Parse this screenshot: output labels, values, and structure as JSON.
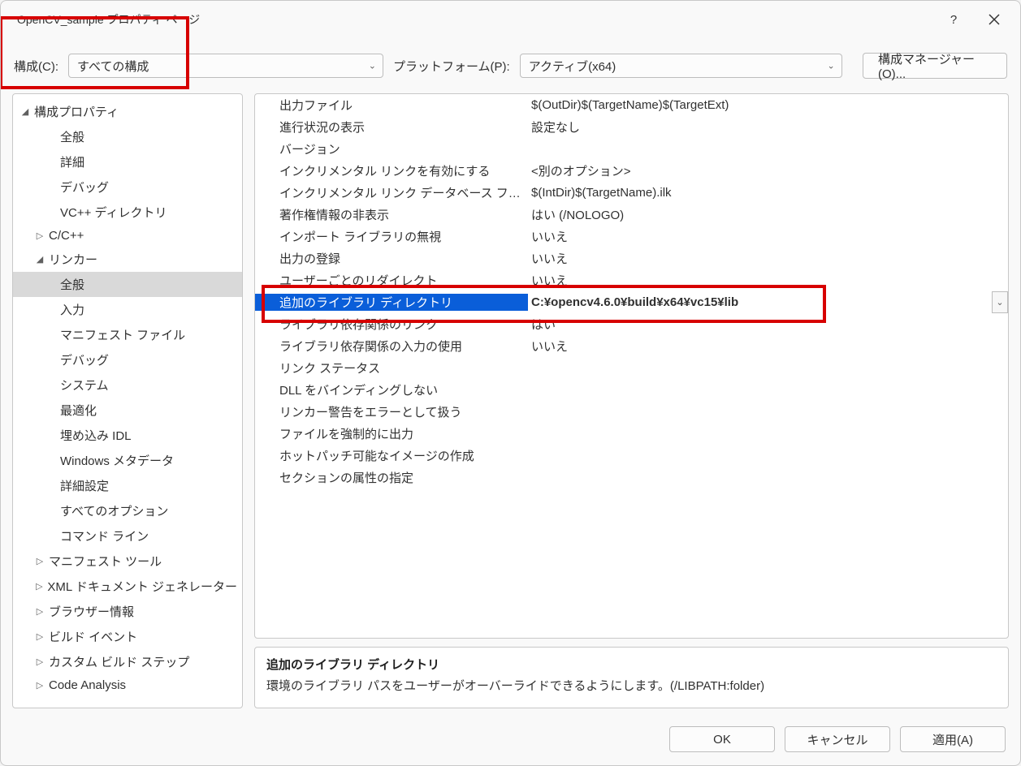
{
  "window": {
    "title": "OpenCV_sample プロパティ ページ",
    "help_icon": "?",
    "close_icon": "✕"
  },
  "toolbar": {
    "config_label": "構成(C):",
    "config_value": "すべての構成",
    "platform_label": "プラットフォーム(P):",
    "platform_value": "アクティブ(x64)",
    "manager_button": "構成マネージャー(O)..."
  },
  "tree": {
    "root": "構成プロパティ",
    "items": [
      {
        "label": "全般",
        "indent": 2
      },
      {
        "label": "詳細",
        "indent": 2
      },
      {
        "label": "デバッグ",
        "indent": 2
      },
      {
        "label": "VC++ ディレクトリ",
        "indent": 2
      },
      {
        "label": "C/C++",
        "indent": 1,
        "arrow": "▷"
      },
      {
        "label": "リンカー",
        "indent": 1,
        "arrow": "◢"
      },
      {
        "label": "全般",
        "indent": 2,
        "selected": true
      },
      {
        "label": "入力",
        "indent": 2
      },
      {
        "label": "マニフェスト ファイル",
        "indent": 2
      },
      {
        "label": "デバッグ",
        "indent": 2
      },
      {
        "label": "システム",
        "indent": 2
      },
      {
        "label": "最適化",
        "indent": 2
      },
      {
        "label": "埋め込み IDL",
        "indent": 2
      },
      {
        "label": "Windows メタデータ",
        "indent": 2
      },
      {
        "label": "詳細設定",
        "indent": 2
      },
      {
        "label": "すべてのオプション",
        "indent": 2
      },
      {
        "label": "コマンド ライン",
        "indent": 2
      },
      {
        "label": "マニフェスト ツール",
        "indent": 1,
        "arrow": "▷"
      },
      {
        "label": "XML ドキュメント ジェネレーター",
        "indent": 1,
        "arrow": "▷"
      },
      {
        "label": "ブラウザー情報",
        "indent": 1,
        "arrow": "▷"
      },
      {
        "label": "ビルド イベント",
        "indent": 1,
        "arrow": "▷"
      },
      {
        "label": "カスタム ビルド ステップ",
        "indent": 1,
        "arrow": "▷"
      },
      {
        "label": "Code Analysis",
        "indent": 1,
        "arrow": "▷"
      }
    ]
  },
  "properties": {
    "rows": [
      {
        "label": "出力ファイル",
        "value": "$(OutDir)$(TargetName)$(TargetExt)"
      },
      {
        "label": "進行状況の表示",
        "value": "設定なし"
      },
      {
        "label": "バージョン",
        "value": ""
      },
      {
        "label": "インクリメンタル リンクを有効にする",
        "value": "<別のオプション>"
      },
      {
        "label": "インクリメンタル リンク データベース ファイル",
        "value": "$(IntDir)$(TargetName).ilk"
      },
      {
        "label": "著作権情報の非表示",
        "value": "はい (/NOLOGO)"
      },
      {
        "label": "インポート ライブラリの無視",
        "value": "いいえ"
      },
      {
        "label": "出力の登録",
        "value": "いいえ"
      },
      {
        "label": "ユーザーごとのリダイレクト",
        "value": "いいえ"
      },
      {
        "label": "追加のライブラリ ディレクトリ",
        "value": "C:¥opencv4.6.0¥build¥x64¥vc15¥lib",
        "selected": true
      },
      {
        "label": "ライブラリ依存関係のリンク",
        "value": "はい"
      },
      {
        "label": "ライブラリ依存関係の入力の使用",
        "value": "いいえ"
      },
      {
        "label": "リンク ステータス",
        "value": ""
      },
      {
        "label": "DLL をバインディングしない",
        "value": ""
      },
      {
        "label": "リンカー警告をエラーとして扱う",
        "value": ""
      },
      {
        "label": "ファイルを強制的に出力",
        "value": ""
      },
      {
        "label": "ホットパッチ可能なイメージの作成",
        "value": ""
      },
      {
        "label": "セクションの属性の指定",
        "value": ""
      }
    ]
  },
  "description": {
    "title": "追加のライブラリ ディレクトリ",
    "text": "環境のライブラリ パスをユーザーがオーバーライドできるようにします。(/LIBPATH:folder)"
  },
  "footer": {
    "ok": "OK",
    "cancel": "キャンセル",
    "apply": "適用(A)"
  }
}
